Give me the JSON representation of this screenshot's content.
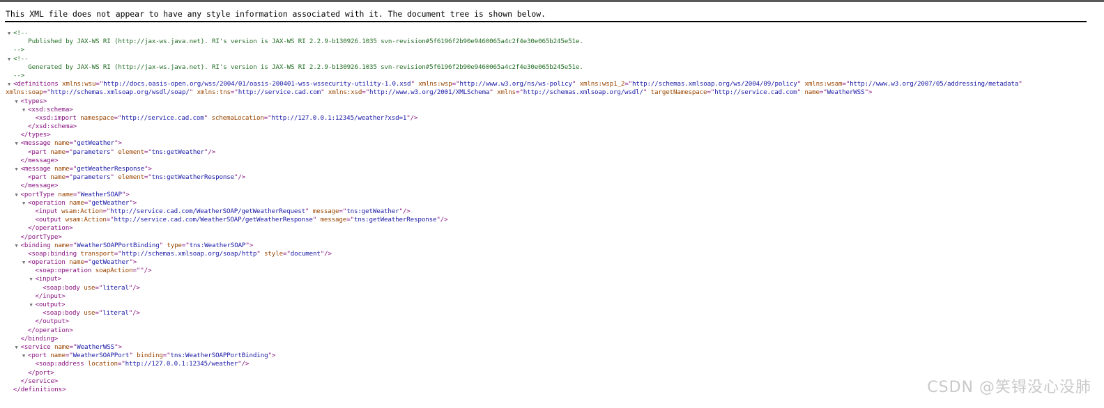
{
  "info_message": "This XML file does not appear to have any style information associated with it. The document tree is shown below.",
  "toggle_glyph": "▼",
  "watermark": "CSDN @笑锝没心没肺",
  "lines": [
    {
      "d": 0,
      "t": 1,
      "p": [
        [
          "cm",
          "<!--"
        ]
      ]
    },
    {
      "d": 1,
      "t": 0,
      "p": [
        [
          "cm",
          "  Published by JAX-WS RI (http://jax-ws.java.net). RI's version is JAX-WS RI 2.2.9-b130926.1035 svn-revision#5f6196f2b90e9460065a4c2f4e30e065b245e51e."
        ]
      ]
    },
    {
      "d": 0,
      "t": 0,
      "p": [
        [
          "cm",
          "-->"
        ]
      ]
    },
    {
      "d": 0,
      "t": 1,
      "p": [
        [
          "cm",
          "<!--"
        ]
      ]
    },
    {
      "d": 1,
      "t": 0,
      "p": [
        [
          "cm",
          "  Generated by JAX-WS RI (http://jax-ws.java.net). RI's version is JAX-WS RI 2.2.9-b130926.1035 svn-revision#5f6196f2b90e9460065a4c2f4e30e065b245e51e."
        ]
      ]
    },
    {
      "d": 0,
      "t": 0,
      "p": [
        [
          "cm",
          "-->"
        ]
      ]
    },
    {
      "d": 0,
      "t": 1,
      "p": [
        [
          "tag",
          "<definitions "
        ],
        [
          "an",
          "xmlns:wsu"
        ],
        [
          "tag",
          "=\""
        ],
        [
          "av",
          "http://docs.oasis-open.org/wss/2004/01/oasis-200401-wss-wssecurity-utility-1.0.xsd"
        ],
        [
          "tag",
          "\" "
        ],
        [
          "an",
          "xmlns:wsp"
        ],
        [
          "tag",
          "=\""
        ],
        [
          "av",
          "http://www.w3.org/ns/ws-policy"
        ],
        [
          "tag",
          "\" "
        ],
        [
          "an",
          "xmlns:wsp1_2"
        ],
        [
          "tag",
          "=\""
        ],
        [
          "av",
          "http://schemas.xmlsoap.org/ws/2004/09/policy"
        ],
        [
          "tag",
          "\" "
        ],
        [
          "an",
          "xmlns:wsam"
        ],
        [
          "tag",
          "=\""
        ],
        [
          "av",
          "http://www.w3.org/2007/05/addressing/metadata"
        ],
        [
          "tag",
          "\""
        ]
      ]
    },
    {
      "d": 0,
      "t": 0,
      "x": 1,
      "p": [
        [
          "an",
          "xmlns:soap"
        ],
        [
          "tag",
          "=\""
        ],
        [
          "av",
          "http://schemas.xmlsoap.org/wsdl/soap/"
        ],
        [
          "tag",
          "\" "
        ],
        [
          "an",
          "xmlns:tns"
        ],
        [
          "tag",
          "=\""
        ],
        [
          "av",
          "http://service.cad.com"
        ],
        [
          "tag",
          "\" "
        ],
        [
          "an",
          "xmlns:xsd"
        ],
        [
          "tag",
          "=\""
        ],
        [
          "av",
          "http://www.w3.org/2001/XMLSchema"
        ],
        [
          "tag",
          "\" "
        ],
        [
          "an",
          "xmlns"
        ],
        [
          "tag",
          "=\""
        ],
        [
          "av",
          "http://schemas.xmlsoap.org/wsdl/"
        ],
        [
          "tag",
          "\" "
        ],
        [
          "an",
          "targetNamespace"
        ],
        [
          "tag",
          "=\""
        ],
        [
          "av",
          "http://service.cad.com"
        ],
        [
          "tag",
          "\" "
        ],
        [
          "an",
          "name"
        ],
        [
          "tag",
          "=\""
        ],
        [
          "av",
          "WeatherWSS"
        ],
        [
          "tag",
          "\">"
        ]
      ]
    },
    {
      "d": 1,
      "t": 1,
      "p": [
        [
          "tag",
          "<types>"
        ]
      ]
    },
    {
      "d": 2,
      "t": 1,
      "p": [
        [
          "tag",
          "<xsd:schema>"
        ]
      ]
    },
    {
      "d": 3,
      "t": 0,
      "p": [
        [
          "tag",
          "<xsd:import "
        ],
        [
          "an",
          "namespace"
        ],
        [
          "tag",
          "=\""
        ],
        [
          "av",
          "http://service.cad.com"
        ],
        [
          "tag",
          "\" "
        ],
        [
          "an",
          "schemaLocation"
        ],
        [
          "tag",
          "=\""
        ],
        [
          "av",
          "http://127.0.0.1:12345/weather?xsd=1"
        ],
        [
          "tag",
          "\"/>"
        ]
      ]
    },
    {
      "d": 2,
      "t": 0,
      "p": [
        [
          "tag",
          "</xsd:schema>"
        ]
      ]
    },
    {
      "d": 1,
      "t": 0,
      "p": [
        [
          "tag",
          "</types>"
        ]
      ]
    },
    {
      "d": 1,
      "t": 1,
      "p": [
        [
          "tag",
          "<message "
        ],
        [
          "an",
          "name"
        ],
        [
          "tag",
          "=\""
        ],
        [
          "av",
          "getWeather"
        ],
        [
          "tag",
          "\">"
        ]
      ]
    },
    {
      "d": 2,
      "t": 0,
      "p": [
        [
          "tag",
          "<part "
        ],
        [
          "an",
          "name"
        ],
        [
          "tag",
          "=\""
        ],
        [
          "av",
          "parameters"
        ],
        [
          "tag",
          "\" "
        ],
        [
          "an",
          "element"
        ],
        [
          "tag",
          "=\""
        ],
        [
          "av",
          "tns:getWeather"
        ],
        [
          "tag",
          "\"/>"
        ]
      ]
    },
    {
      "d": 1,
      "t": 0,
      "p": [
        [
          "tag",
          "</message>"
        ]
      ]
    },
    {
      "d": 1,
      "t": 1,
      "p": [
        [
          "tag",
          "<message "
        ],
        [
          "an",
          "name"
        ],
        [
          "tag",
          "=\""
        ],
        [
          "av",
          "getWeatherResponse"
        ],
        [
          "tag",
          "\">"
        ]
      ]
    },
    {
      "d": 2,
      "t": 0,
      "p": [
        [
          "tag",
          "<part "
        ],
        [
          "an",
          "name"
        ],
        [
          "tag",
          "=\""
        ],
        [
          "av",
          "parameters"
        ],
        [
          "tag",
          "\" "
        ],
        [
          "an",
          "element"
        ],
        [
          "tag",
          "=\""
        ],
        [
          "av",
          "tns:getWeatherResponse"
        ],
        [
          "tag",
          "\"/>"
        ]
      ]
    },
    {
      "d": 1,
      "t": 0,
      "p": [
        [
          "tag",
          "</message>"
        ]
      ]
    },
    {
      "d": 1,
      "t": 1,
      "p": [
        [
          "tag",
          "<portType "
        ],
        [
          "an",
          "name"
        ],
        [
          "tag",
          "=\""
        ],
        [
          "av",
          "WeatherSOAP"
        ],
        [
          "tag",
          "\">"
        ]
      ]
    },
    {
      "d": 2,
      "t": 1,
      "p": [
        [
          "tag",
          "<operation "
        ],
        [
          "an",
          "name"
        ],
        [
          "tag",
          "=\""
        ],
        [
          "av",
          "getWeather"
        ],
        [
          "tag",
          "\">"
        ]
      ]
    },
    {
      "d": 3,
      "t": 0,
      "p": [
        [
          "tag",
          "<input "
        ],
        [
          "an",
          "wsam:Action"
        ],
        [
          "tag",
          "=\""
        ],
        [
          "av",
          "http://service.cad.com/WeatherSOAP/getWeatherRequest"
        ],
        [
          "tag",
          "\" "
        ],
        [
          "an",
          "message"
        ],
        [
          "tag",
          "=\""
        ],
        [
          "av",
          "tns:getWeather"
        ],
        [
          "tag",
          "\"/>"
        ]
      ]
    },
    {
      "d": 3,
      "t": 0,
      "p": [
        [
          "tag",
          "<output "
        ],
        [
          "an",
          "wsam:Action"
        ],
        [
          "tag",
          "=\""
        ],
        [
          "av",
          "http://service.cad.com/WeatherSOAP/getWeatherResponse"
        ],
        [
          "tag",
          "\" "
        ],
        [
          "an",
          "message"
        ],
        [
          "tag",
          "=\""
        ],
        [
          "av",
          "tns:getWeatherResponse"
        ],
        [
          "tag",
          "\"/>"
        ]
      ]
    },
    {
      "d": 2,
      "t": 0,
      "p": [
        [
          "tag",
          "</operation>"
        ]
      ]
    },
    {
      "d": 1,
      "t": 0,
      "p": [
        [
          "tag",
          "</portType>"
        ]
      ]
    },
    {
      "d": 1,
      "t": 1,
      "p": [
        [
          "tag",
          "<binding "
        ],
        [
          "an",
          "name"
        ],
        [
          "tag",
          "=\""
        ],
        [
          "av",
          "WeatherSOAPPortBinding"
        ],
        [
          "tag",
          "\" "
        ],
        [
          "an",
          "type"
        ],
        [
          "tag",
          "=\""
        ],
        [
          "av",
          "tns:WeatherSOAP"
        ],
        [
          "tag",
          "\">"
        ]
      ]
    },
    {
      "d": 2,
      "t": 0,
      "p": [
        [
          "tag",
          "<soap:binding "
        ],
        [
          "an",
          "transport"
        ],
        [
          "tag",
          "=\""
        ],
        [
          "av",
          "http://schemas.xmlsoap.org/soap/http"
        ],
        [
          "tag",
          "\" "
        ],
        [
          "an",
          "style"
        ],
        [
          "tag",
          "=\""
        ],
        [
          "av",
          "document"
        ],
        [
          "tag",
          "\"/>"
        ]
      ]
    },
    {
      "d": 2,
      "t": 1,
      "p": [
        [
          "tag",
          "<operation "
        ],
        [
          "an",
          "name"
        ],
        [
          "tag",
          "=\""
        ],
        [
          "av",
          "getWeather"
        ],
        [
          "tag",
          "\">"
        ]
      ]
    },
    {
      "d": 3,
      "t": 0,
      "p": [
        [
          "tag",
          "<soap:operation "
        ],
        [
          "an",
          "soapAction"
        ],
        [
          "tag",
          "=\"\"/>"
        ]
      ]
    },
    {
      "d": 3,
      "t": 1,
      "p": [
        [
          "tag",
          "<input>"
        ]
      ]
    },
    {
      "d": 4,
      "t": 0,
      "p": [
        [
          "tag",
          "<soap:body "
        ],
        [
          "an",
          "use"
        ],
        [
          "tag",
          "=\""
        ],
        [
          "av",
          "literal"
        ],
        [
          "tag",
          "\"/>"
        ]
      ]
    },
    {
      "d": 3,
      "t": 0,
      "p": [
        [
          "tag",
          "</input>"
        ]
      ]
    },
    {
      "d": 3,
      "t": 1,
      "p": [
        [
          "tag",
          "<output>"
        ]
      ]
    },
    {
      "d": 4,
      "t": 0,
      "p": [
        [
          "tag",
          "<soap:body "
        ],
        [
          "an",
          "use"
        ],
        [
          "tag",
          "=\""
        ],
        [
          "av",
          "literal"
        ],
        [
          "tag",
          "\"/>"
        ]
      ]
    },
    {
      "d": 3,
      "t": 0,
      "p": [
        [
          "tag",
          "</output>"
        ]
      ]
    },
    {
      "d": 2,
      "t": 0,
      "p": [
        [
          "tag",
          "</operation>"
        ]
      ]
    },
    {
      "d": 1,
      "t": 0,
      "p": [
        [
          "tag",
          "</binding>"
        ]
      ]
    },
    {
      "d": 1,
      "t": 1,
      "p": [
        [
          "tag",
          "<service "
        ],
        [
          "an",
          "name"
        ],
        [
          "tag",
          "=\""
        ],
        [
          "av",
          "WeatherWSS"
        ],
        [
          "tag",
          "\">"
        ]
      ]
    },
    {
      "d": 2,
      "t": 1,
      "p": [
        [
          "tag",
          "<port "
        ],
        [
          "an",
          "name"
        ],
        [
          "tag",
          "=\""
        ],
        [
          "av",
          "WeatherSOAPPort"
        ],
        [
          "tag",
          "\" "
        ],
        [
          "an",
          "binding"
        ],
        [
          "tag",
          "=\""
        ],
        [
          "av",
          "tns:WeatherSOAPPortBinding"
        ],
        [
          "tag",
          "\">"
        ]
      ]
    },
    {
      "d": 3,
      "t": 0,
      "p": [
        [
          "tag",
          "<soap:address "
        ],
        [
          "an",
          "location"
        ],
        [
          "tag",
          "=\""
        ],
        [
          "av",
          "http://127.0.0.1:12345/weather"
        ],
        [
          "tag",
          "\"/>"
        ]
      ]
    },
    {
      "d": 2,
      "t": 0,
      "p": [
        [
          "tag",
          "</port>"
        ]
      ]
    },
    {
      "d": 1,
      "t": 0,
      "p": [
        [
          "tag",
          "</service>"
        ]
      ]
    },
    {
      "d": 0,
      "t": 0,
      "p": [
        [
          "tag",
          "</definitions>"
        ]
      ]
    }
  ]
}
